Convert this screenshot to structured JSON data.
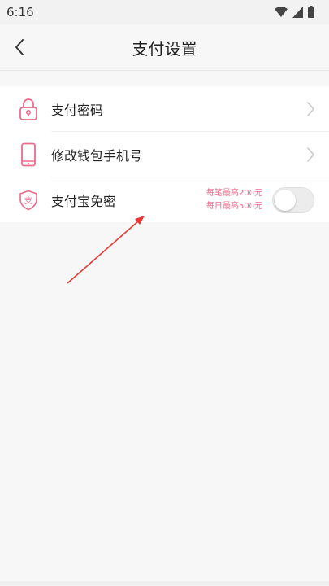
{
  "status_bar": {
    "time": "6:16",
    "icons": [
      "wifi-icon",
      "signal-icon",
      "battery-icon"
    ]
  },
  "nav": {
    "title": "支付设置",
    "back_icon": "chevron-left-icon"
  },
  "settings": {
    "payment_password": {
      "label": "支付密码",
      "icon": "lock-icon"
    },
    "change_phone": {
      "label": "修改钱包手机号",
      "icon": "phone-icon"
    },
    "alipay_free": {
      "label": "支付宝免密",
      "icon": "alipay-shield-icon",
      "icon_glyph": "支",
      "limit_per_txn": "每笔最高200元",
      "limit_per_day": "每日最高500元",
      "enabled": false
    }
  },
  "colors": {
    "accent_pink": "#ee6b8a",
    "annotation_red": "#e53935"
  }
}
